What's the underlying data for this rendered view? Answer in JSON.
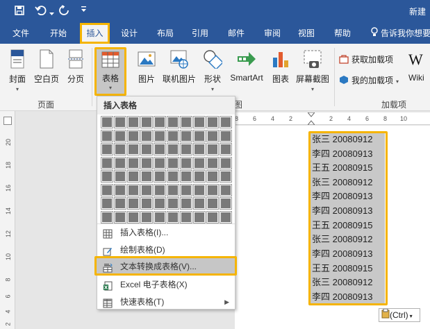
{
  "app": {
    "title_partial": "新建",
    "qa_icons": [
      "save-icon",
      "undo-icon",
      "redo-icon",
      "customize-icon"
    ]
  },
  "menu": {
    "tabs": [
      {
        "label": "文件",
        "name": "tab-file"
      },
      {
        "label": "开始",
        "name": "tab-home"
      },
      {
        "label": "插入",
        "name": "tab-insert"
      },
      {
        "label": "设计",
        "name": "tab-design"
      },
      {
        "label": "布局",
        "name": "tab-layout"
      },
      {
        "label": "引用",
        "name": "tab-references"
      },
      {
        "label": "邮件",
        "name": "tab-mailings"
      },
      {
        "label": "审阅",
        "name": "tab-review"
      },
      {
        "label": "视图",
        "name": "tab-view"
      },
      {
        "label": "帮助",
        "name": "tab-help"
      }
    ],
    "tell_me": "告诉我你想要"
  },
  "ribbon": {
    "cover": "封面",
    "blank_page": "空白页",
    "page_break": "分页",
    "table": "表格",
    "picture": "图片",
    "online_picture": "联机图片",
    "shapes": "形状",
    "smartart": "SmartArt",
    "chart": "图表",
    "screenshot": "屏幕截图",
    "get_addins": "获取加载项",
    "my_addins": "我的加载项",
    "wiki": "Wiki",
    "group_pages": "页面",
    "group_illustrations_tail": "图",
    "group_addins": "加载项"
  },
  "dropdown": {
    "header": "插入表格",
    "grid_cols": 10,
    "grid_rows": 8,
    "items": [
      {
        "label": "插入表格(I)...",
        "name": "menu-insert-table",
        "icon": "table-icon"
      },
      {
        "label": "绘制表格(D)",
        "name": "menu-draw-table",
        "icon": "pencil-icon"
      },
      {
        "label": "文本转换成表格(V)...",
        "name": "menu-text-to-table",
        "icon": "convert-icon"
      },
      {
        "label": "Excel 电子表格(X)",
        "name": "menu-excel-spreadsheet",
        "icon": "excel-icon"
      },
      {
        "label": "快速表格(T)",
        "name": "menu-quick-tables",
        "icon": "quick-table-icon"
      }
    ]
  },
  "ruler": {
    "h_ticks": [
      "8",
      "6",
      "4",
      "2",
      "2",
      "4",
      "6",
      "8",
      "10"
    ],
    "v_ticks": [
      "20",
      "18",
      "16",
      "14",
      "12",
      "10",
      "8",
      "6",
      "4",
      "2"
    ]
  },
  "document": {
    "lines": [
      "张三 20080912",
      "李四 20080913",
      "王五 20080915",
      "张三 20080912",
      "李四 20080913",
      "李四 20080913",
      "王五 20080915",
      "张三 20080912",
      "李四 20080913",
      "王五 20080915",
      "张三 20080912",
      "李四 20080913"
    ]
  },
  "paste_options": "(Ctrl)",
  "colors": {
    "brand": "#2b579a",
    "highlight": "#f5b400"
  }
}
